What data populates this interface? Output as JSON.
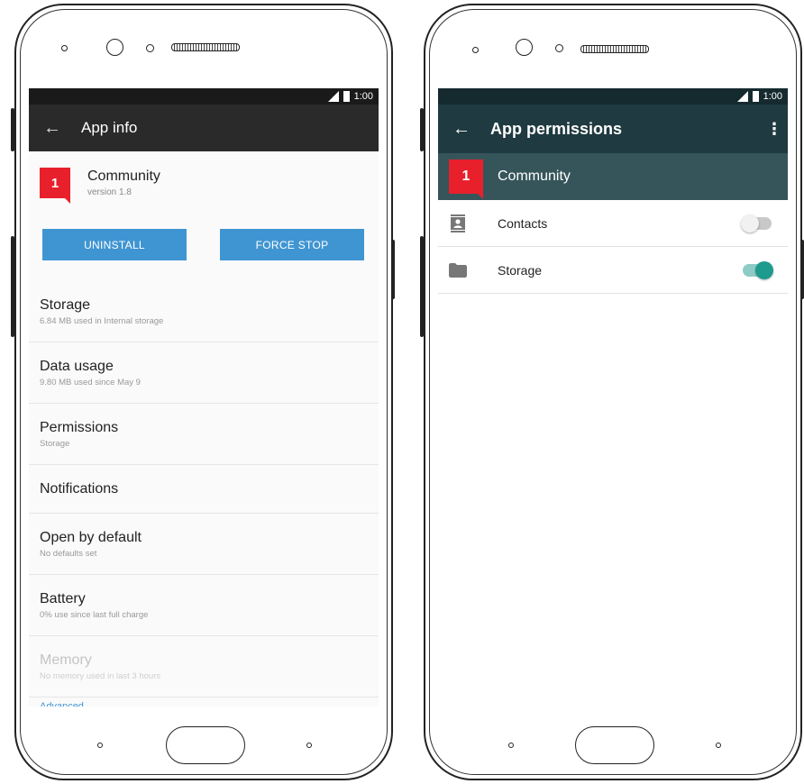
{
  "left_screen": {
    "status_time": "1:00",
    "title": "App info",
    "app": {
      "name": "Community",
      "version": "version 1.8",
      "logo_glyph": "1"
    },
    "buttons": {
      "uninstall": "UNINSTALL",
      "force_stop": "FORCE STOP"
    },
    "items": [
      {
        "title": "Storage",
        "subtitle": "6.84 MB used in Internal storage"
      },
      {
        "title": "Data usage",
        "subtitle": "9.80 MB used since May 9"
      },
      {
        "title": "Permissions",
        "subtitle": "Storage"
      },
      {
        "title": "Notifications"
      },
      {
        "title": "Open by default",
        "subtitle": "No defaults set"
      },
      {
        "title": "Battery",
        "subtitle": "0% use since last full charge"
      },
      {
        "title": "Memory",
        "subtitle": "No memory used in last 3 hours"
      }
    ],
    "advanced": "Advanced"
  },
  "right_screen": {
    "status_time": "1:00",
    "title": "App permissions",
    "app": {
      "name": "Community",
      "logo_glyph": "1"
    },
    "permissions": [
      {
        "label": "Contacts",
        "enabled": false,
        "icon": "contacts-icon"
      },
      {
        "label": "Storage",
        "enabled": true,
        "icon": "folder-icon"
      }
    ]
  },
  "colors": {
    "accent_blue": "#3f95d2",
    "brand_red": "#e8202c",
    "toggle_on": "#1e9a8e",
    "appbar_teal": "#1f3a40"
  }
}
